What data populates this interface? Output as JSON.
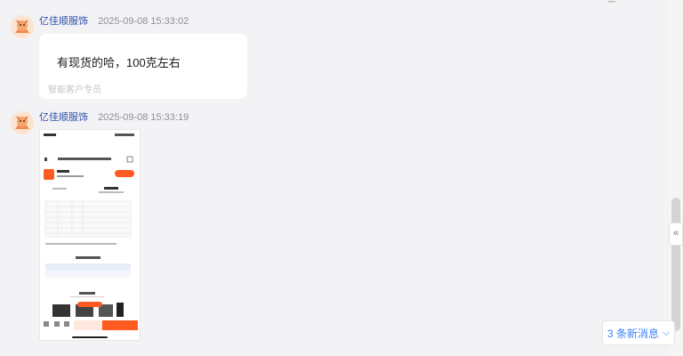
{
  "messages": [
    {
      "shop_name": "亿佳顺服饰",
      "time": "2025-09-08 15:33:02",
      "text": "有现货的哈，100克左右",
      "sub": "智能客户专员"
    },
    {
      "shop_name": "亿佳顺服饰",
      "time": "2025-09-08 15:33:19",
      "type": "image"
    }
  ],
  "new_messages": {
    "label": "3 条新消息",
    "icon": "chevron-down-icon"
  },
  "collapse_icon": "double-chevron-left-icon",
  "colors": {
    "shop_name": "#2e4fa7",
    "accent_orange": "#ff5a1f",
    "link_blue": "#3b82f6"
  }
}
